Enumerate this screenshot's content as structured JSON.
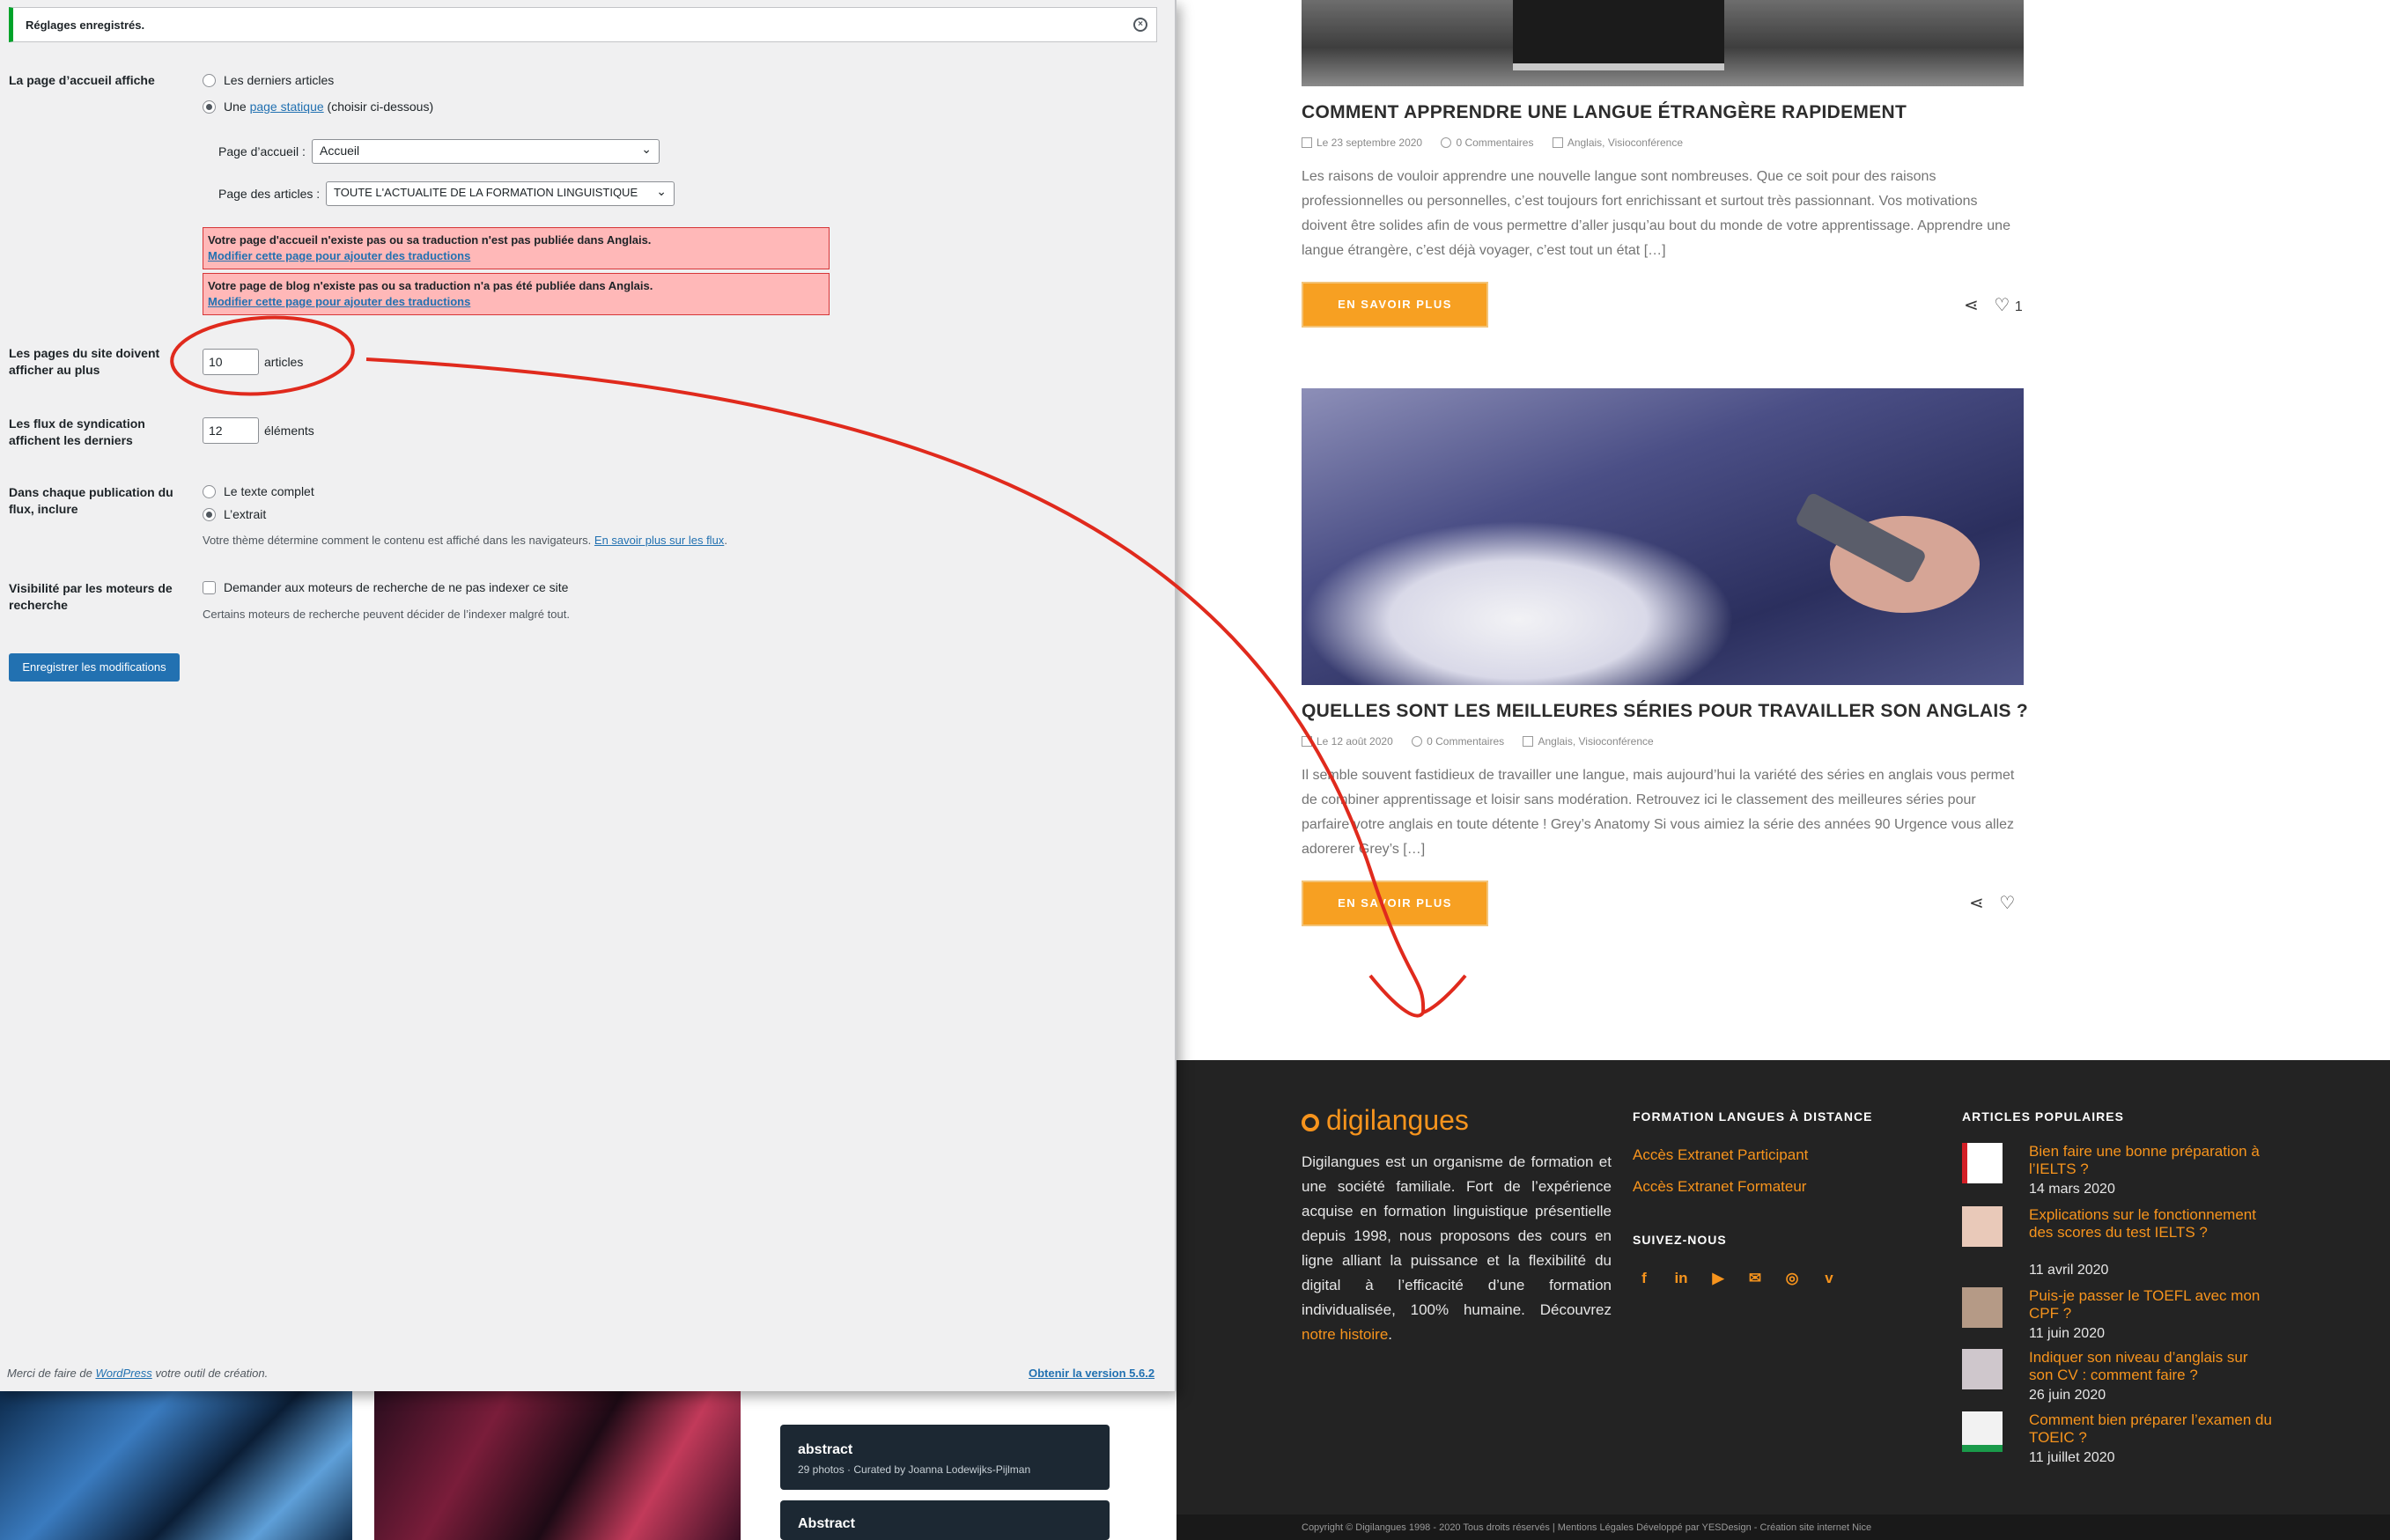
{
  "wp": {
    "notice": "Réglages enregistrés.",
    "front_label": "La page d’accueil affiche",
    "radio_latest": "Les derniers articles",
    "radio_static_prefix": "Une ",
    "radio_static_link": "page statique",
    "radio_static_suffix": " (choisir ci-dessous)",
    "home_label": "Page d’accueil :",
    "home_value": "Accueil",
    "posts_label": "Page des articles :",
    "posts_value": "TOUTE L'ACTUALITE DE LA FORMATION LINGUISTIQUE",
    "warn1_text": "Votre page d'accueil n'existe pas ou sa traduction n'est pas publiée dans Anglais.",
    "warn1_link": "Modifier cette page pour ajouter des traductions",
    "warn2_text": "Votre page de blog n'existe pas ou sa traduction n'a pas été publiée dans Anglais.",
    "warn2_link": "Modifier cette page pour ajouter des traductions",
    "per_page_label": "Les pages du site doivent afficher au plus",
    "per_page_value": "10",
    "per_page_unit": "articles",
    "feed_label": "Les flux de syndication affichent les derniers",
    "feed_value": "12",
    "feed_unit": "éléments",
    "include_label": "Dans chaque publication du flux, inclure",
    "radio_full": "Le texte complet",
    "radio_excerpt": "L’extrait",
    "theme_note": "Votre thème détermine comment le contenu est affiché dans les navigateurs. ",
    "theme_link": "En savoir plus sur les flux",
    "visibility_label": "Visibilité par les moteurs de recherche",
    "noindex_label": "Demander aux moteurs de recherche de ne pas indexer ce site",
    "noindex_note": "Certains moteurs de recherche peuvent décider de l’indexer malgré tout.",
    "save_label": "Enregistrer les modifications",
    "footer_prefix": "Merci de faire de ",
    "footer_link": "WordPress",
    "footer_suffix": " votre outil de création.",
    "version_link": "Obtenir la version 5.6.2"
  },
  "stock": {
    "card1_title": "abstract",
    "card1_sub": "29 photos · Curated by Joanna Lodewijks-Pijlman",
    "card2_title": "Abstract"
  },
  "blog": {
    "post1": {
      "title": "COMMENT APPRENDRE UNE LANGUE ÉTRANGÈRE RAPIDEMENT",
      "date": "Le 23 septembre 2020",
      "comments": "0 Commentaires",
      "cats": "Anglais, Visioconférence",
      "excerpt": "Les raisons de vouloir apprendre une nouvelle langue sont nombreuses. Que ce soit pour des raisons professionnelles ou personnelles, c’est toujours fort enrichissant et surtout très passionnant. Vos motivations doivent être solides afin de vous permettre d’aller jusqu’au bout du monde de votre apprentissage. Apprendre une langue étrangère, c’est déjà voyager, c’est tout un état […]",
      "more": "EN SAVOIR PLUS",
      "likes": "1"
    },
    "post2": {
      "title": "QUELLES SONT LES MEILLEURES SÉRIES POUR TRAVAILLER SON ANGLAIS ?",
      "date": "Le 12 août 2020",
      "comments": "0 Commentaires",
      "cats": "Anglais, Visioconférence",
      "excerpt": "Il semble souvent fastidieux de travailler une langue, mais aujourd’hui la variété des séries en anglais vous permet de combiner apprentissage et loisir sans modération. Retrouvez ici le classement des meilleures séries pour parfaire votre anglais en toute détente ! Grey’s Anatomy Si vous aimiez la série des années 90 Urgence vous allez adorerer Grey’s […]",
      "more": "EN SAVOIR PLUS"
    },
    "footer": {
      "logo": "digilangues",
      "about_text": "Digilangues est un organisme de formation et une société familiale. Fort de l’expérience acquise en formation linguistique présentielle depuis 1998, nous proposons des cours en ligne alliant la puissance et la flexibilité du digital à l’efficacité d’une formation individualisée, 100% humaine. Découvrez ",
      "about_link": "notre histoire",
      "about_end": ".",
      "col2_title": "FORMATION LANGUES À DISTANCE",
      "link_participant": "Accès Extranet Participant",
      "link_formateur": "Accès Extranet Formateur",
      "follow_title": "SUIVEZ-NOUS",
      "col3_title": "ARTICLES POPULAIRES",
      "popular": [
        {
          "title": "Bien faire une bonne préparation à l’IELTS ?",
          "date": "14 mars 2020"
        },
        {
          "title": "Explications sur le fonctionnement des scores du test IELTS ?",
          "date": "11 avril 2020"
        },
        {
          "title": "Puis-je passer le TOEFL avec mon CPF ?",
          "date": "11 juin 2020"
        },
        {
          "title": "Indiquer son niveau d’anglais sur son CV : comment faire ?",
          "date": "26 juin 2020"
        },
        {
          "title": "Comment bien préparer l’examen du TOEIC ?",
          "date": "11 juillet 2020"
        }
      ],
      "copyright": "Copyright © Digilangues 1998 - 2020 Tous droits réservés | Mentions Légales Développé par YESDesign - Création site internet Nice"
    }
  },
  "colors": {
    "wp_blue": "#2271b1",
    "orange": "#f7a022",
    "annotation_red": "#e02a1d"
  }
}
